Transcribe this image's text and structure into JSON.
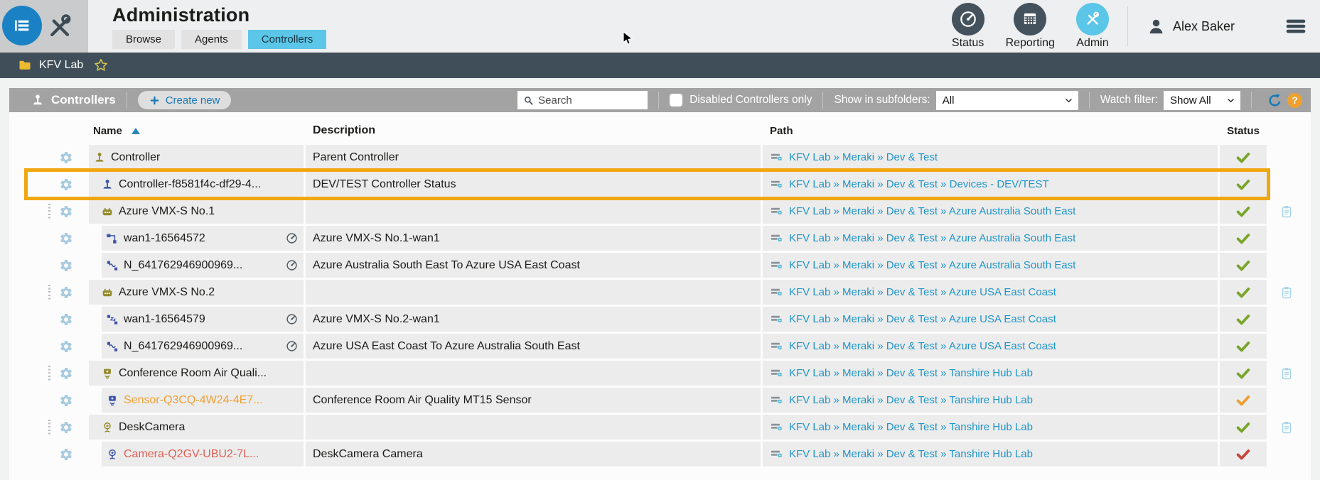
{
  "header": {
    "title": "Administration",
    "tabs": [
      {
        "label": "Browse",
        "active": false
      },
      {
        "label": "Agents",
        "active": false
      },
      {
        "label": "Controllers",
        "active": true
      }
    ],
    "nav": [
      {
        "label": "Status",
        "icon": "gauge",
        "active": false
      },
      {
        "label": "Reporting",
        "icon": "report-table",
        "active": false
      },
      {
        "label": "Admin",
        "icon": "tools",
        "active": true
      }
    ],
    "user": "Alex Baker"
  },
  "breadcrumb": {
    "label": "KFV Lab"
  },
  "toolbar": {
    "section_label": "Controllers",
    "create_button": "Create new",
    "search_placeholder": "Search",
    "disabled_only_label": "Disabled Controllers only",
    "subfolders_label": "Show in subfolders:",
    "subfolders_value": "All",
    "watch_label": "Watch filter:",
    "watch_value": "Show All",
    "help_glyph": "?"
  },
  "table": {
    "columns": [
      "Name",
      "Description",
      "Path",
      "Status"
    ],
    "rows": [
      {
        "name": "Controller",
        "desc": "Parent Controller",
        "path": "KFV Lab » Meraki » Dev & Test",
        "status": "ok",
        "icon": "joystick",
        "icon_color": "olive",
        "indent": 0,
        "drag": false,
        "gauge": false,
        "clipboard": false,
        "highlight": false
      },
      {
        "name": "Controller-f8581f4c-df29-4...",
        "desc": "DEV/TEST Controller Status",
        "path": "KFV Lab » Meraki » Dev & Test » Devices - DEV/TEST",
        "status": "ok",
        "icon": "joystick",
        "icon_color": "blue",
        "indent": 1,
        "drag": false,
        "gauge": false,
        "clipboard": false,
        "highlight": true
      },
      {
        "name": "Azure VMX-S No.1",
        "desc": "",
        "path": "KFV Lab » Meraki » Dev & Test » Azure Australia South East",
        "status": "ok",
        "icon": "robot",
        "icon_color": "olive",
        "indent": 1,
        "drag": true,
        "gauge": false,
        "clipboard": true,
        "highlight": false
      },
      {
        "name": "wan1-16564572",
        "desc": "Azure VMX-S No.1-wan1",
        "path": "KFV Lab » Meraki » Dev & Test » Azure Australia South East",
        "status": "ok",
        "icon": "wan-l",
        "icon_color": "blue",
        "indent": 2,
        "drag": false,
        "gauge": true,
        "clipboard": false,
        "highlight": false
      },
      {
        "name": "N_641762946900969...",
        "desc": "Azure Australia South East To Azure USA East Coast",
        "path": "KFV Lab » Meraki » Dev & Test » Azure Australia South East",
        "status": "ok",
        "icon": "vpn",
        "icon_color": "blue",
        "indent": 2,
        "drag": false,
        "gauge": true,
        "clipboard": false,
        "highlight": false
      },
      {
        "name": "Azure VMX-S No.2",
        "desc": "",
        "path": "KFV Lab » Meraki » Dev & Test » Azure USA East Coast",
        "status": "ok",
        "icon": "robot",
        "icon_color": "olive",
        "indent": 1,
        "drag": true,
        "gauge": false,
        "clipboard": true,
        "highlight": false
      },
      {
        "name": "wan1-16564579",
        "desc": "Azure VMX-S No.2-wan1",
        "path": "KFV Lab » Meraki » Dev & Test » Azure USA East Coast",
        "status": "ok",
        "icon": "wan-z",
        "icon_color": "blue",
        "indent": 2,
        "drag": false,
        "gauge": true,
        "clipboard": false,
        "highlight": false
      },
      {
        "name": "N_641762946900969...",
        "desc": "Azure USA East Coast To Azure Australia South East",
        "path": "KFV Lab » Meraki » Dev & Test » Azure USA East Coast",
        "status": "ok",
        "icon": "vpn",
        "icon_color": "blue",
        "indent": 2,
        "drag": false,
        "gauge": true,
        "clipboard": false,
        "highlight": false
      },
      {
        "name": "Conference Room Air Quali...",
        "desc": "",
        "path": "KFV Lab » Meraki » Dev & Test » Tanshire Hub Lab",
        "status": "ok",
        "icon": "sensor",
        "icon_color": "olive",
        "indent": 1,
        "drag": true,
        "gauge": false,
        "clipboard": true,
        "highlight": false
      },
      {
        "name": "Sensor-Q3CQ-4W24-4E7...",
        "desc": "Conference Room Air Quality MT15 Sensor",
        "path": "KFV Lab » Meraki » Dev & Test » Tanshire Hub Lab",
        "status": "warn",
        "icon": "sensor",
        "icon_color": "blue",
        "name_color": "orange",
        "indent": 2,
        "drag": false,
        "gauge": false,
        "clipboard": false,
        "highlight": false
      },
      {
        "name": "DeskCamera",
        "desc": "",
        "path": "KFV Lab » Meraki » Dev & Test » Tanshire Hub Lab",
        "status": "ok",
        "icon": "camera",
        "icon_color": "olive",
        "indent": 1,
        "drag": true,
        "gauge": false,
        "clipboard": true,
        "highlight": false
      },
      {
        "name": "Camera-Q2GV-UBU2-7L...",
        "desc": "DeskCamera Camera",
        "path": "KFV Lab » Meraki » Dev & Test » Tanshire Hub Lab",
        "status": "error",
        "icon": "camera",
        "icon_color": "blue",
        "name_color": "red",
        "indent": 2,
        "drag": false,
        "gauge": false,
        "clipboard": false,
        "highlight": false
      }
    ]
  },
  "colors": {
    "accent_blue": "#1779ba",
    "active_tab_blue": "#5bc6e8",
    "dark_slate": "#3f4e59",
    "toolbar_gray": "#a3a3a3",
    "link_blue": "#1f95c8",
    "row_bg": "#ececec",
    "highlight_orange": "#f0a712",
    "status_ok_green": "#7aa52c",
    "status_warn_orange": "#efa02f",
    "status_error_red": "#c8453c",
    "device_olive": "#958a2c",
    "device_blue": "#3d55a8",
    "gear_blue": "#a9cbe0",
    "folder_yellow": "#ecba2f"
  }
}
